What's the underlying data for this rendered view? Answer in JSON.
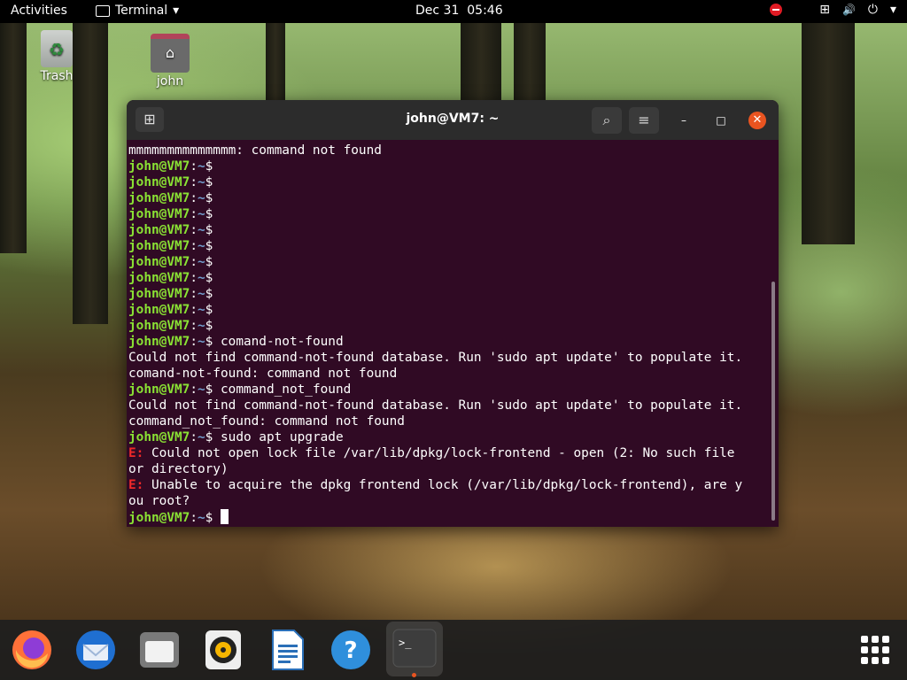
{
  "topbar": {
    "activities": "Activities",
    "app_menu": "Terminal",
    "app_menu_caret": "▾",
    "clock": "Dec 31  05:46",
    "tray": {
      "network": "⊞",
      "volume": "🔊",
      "power": "⏻",
      "caret": "▾"
    }
  },
  "desktop": {
    "trash_label": "Trash",
    "home_label": "john"
  },
  "window": {
    "title": "john@VM7: ~",
    "newtab_icon": "⊞",
    "search_icon": "⌕",
    "menu_icon": "≡",
    "minimize_icon": "–",
    "maximize_icon": "□",
    "close_icon": "✕"
  },
  "terminal": {
    "user": "john@VM7",
    "path": "~",
    "prompt_symbol": "$",
    "lines": [
      {
        "type": "out",
        "text": "mmmmmmmmmmmmmm: command not found"
      },
      {
        "type": "prompt",
        "cmd": ""
      },
      {
        "type": "prompt",
        "cmd": ""
      },
      {
        "type": "prompt",
        "cmd": ""
      },
      {
        "type": "prompt",
        "cmd": ""
      },
      {
        "type": "prompt",
        "cmd": ""
      },
      {
        "type": "prompt",
        "cmd": ""
      },
      {
        "type": "prompt",
        "cmd": ""
      },
      {
        "type": "prompt",
        "cmd": ""
      },
      {
        "type": "prompt",
        "cmd": ""
      },
      {
        "type": "prompt",
        "cmd": ""
      },
      {
        "type": "prompt",
        "cmd": ""
      },
      {
        "type": "prompt",
        "cmd": " comand-not-found"
      },
      {
        "type": "out",
        "text": "Could not find command-not-found database. Run 'sudo apt update' to populate it."
      },
      {
        "type": "out",
        "text": "comand-not-found: command not found"
      },
      {
        "type": "prompt",
        "cmd": " command_not_found"
      },
      {
        "type": "out",
        "text": "Could not find command-not-found database. Run 'sudo apt update' to populate it."
      },
      {
        "type": "out",
        "text": "command_not_found: command not found"
      },
      {
        "type": "prompt",
        "cmd": " sudo apt upgrade"
      },
      {
        "type": "err",
        "tag": "E:",
        "text": " Could not open lock file /var/lib/dpkg/lock-frontend - open (2: No such file"
      },
      {
        "type": "out",
        "text": "or directory)"
      },
      {
        "type": "err",
        "tag": "E:",
        "text": " Unable to acquire the dpkg frontend lock (/var/lib/dpkg/lock-frontend), are y"
      },
      {
        "type": "out",
        "text": "ou root?"
      },
      {
        "type": "prompt",
        "cmd": " ",
        "cursor": true
      }
    ]
  },
  "dock": {
    "items": [
      {
        "name": "firefox-icon"
      },
      {
        "name": "thunderbird-icon"
      },
      {
        "name": "files-icon"
      },
      {
        "name": "rhythmbox-icon"
      },
      {
        "name": "libreoffice-writer-icon"
      },
      {
        "name": "help-icon",
        "glyph": "?"
      },
      {
        "name": "terminal-icon",
        "glyph": ">_",
        "active": true
      }
    ],
    "show_apps_label": "Show Applications"
  },
  "colors": {
    "terminal_bg": "#300a24",
    "prompt_user": "#8ae234",
    "prompt_path": "#729fcf",
    "error": "#ef2929",
    "accent": "#e95420"
  }
}
